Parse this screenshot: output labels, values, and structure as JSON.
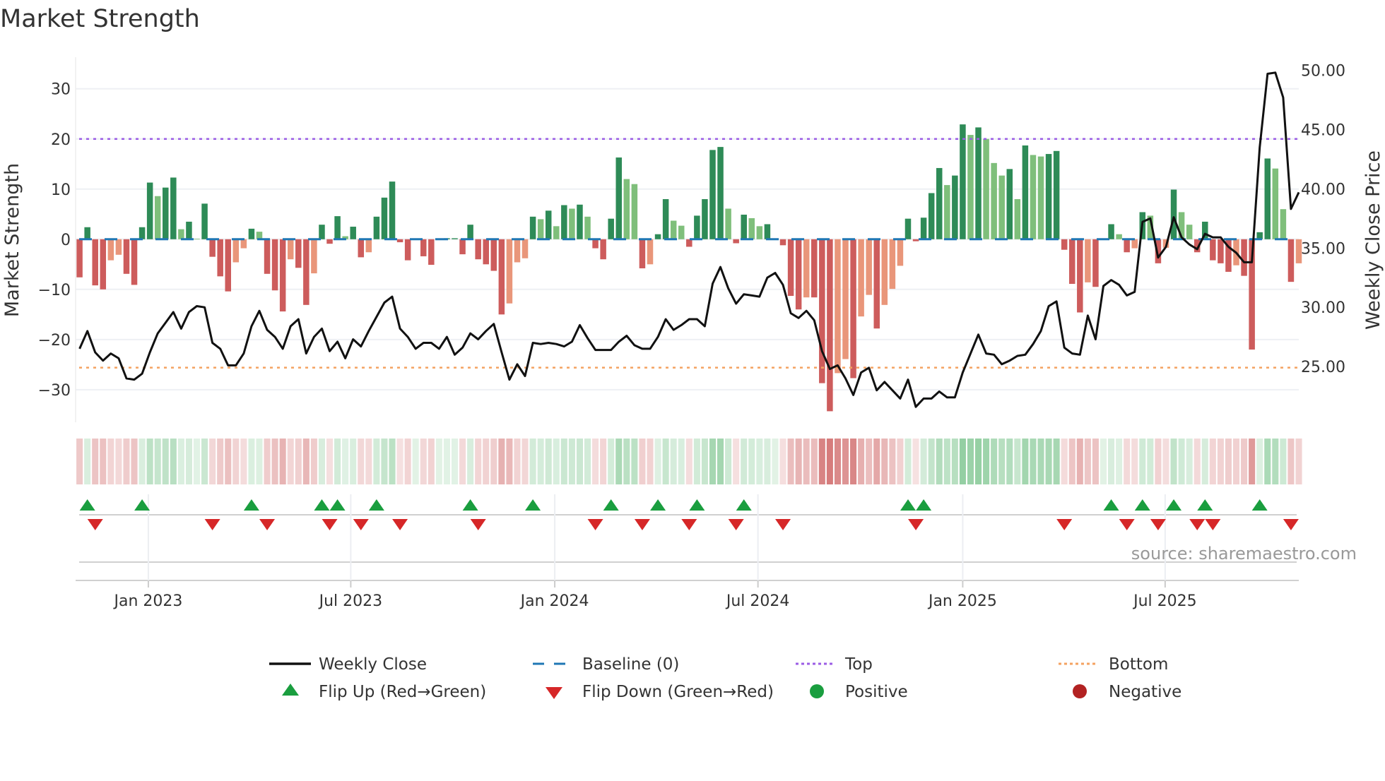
{
  "title": "Market Strength",
  "source": "source: sharemaestro.com",
  "colors": {
    "pos_strong": "#2e8b57",
    "pos_weak": "#7fbf7b",
    "neg_strong": "#cd5c5c",
    "neg_weak": "#e9967a",
    "line": "#111111",
    "baseline": "#1f77b4",
    "top": "#9b5de5",
    "bottom": "#f4a261",
    "flip_up": "#1a9e3f",
    "flip_down": "#d62728",
    "positive": "#1a9e3f",
    "negative": "#b22222"
  },
  "chart_data": {
    "type": "bar+line",
    "title": "Market Strength",
    "ylabel": "Market Strength",
    "y2label": "Weekly Close Price",
    "ylim": [
      -36.5,
      36.3
    ],
    "y2lim": [
      20.3,
      51.1
    ],
    "yticks": [
      30,
      20,
      10,
      0,
      -10,
      -20,
      -30
    ],
    "ytick_labels": [
      "30",
      "20",
      "10",
      "0",
      "−10",
      "−20",
      "−30"
    ],
    "y2ticks": [
      50,
      45,
      40,
      35,
      30,
      25
    ],
    "y2tick_labels": [
      "50.00",
      "45.00",
      "40.00",
      "35.00",
      "30.00",
      "25.00"
    ],
    "xticks": [
      {
        "label": "Jan 2023",
        "week": 8.8
      },
      {
        "label": "Jul 2023",
        "week": 34.7
      },
      {
        "label": "Jan 2024",
        "week": 60.8
      },
      {
        "label": "Jul 2024",
        "week": 86.8
      },
      {
        "label": "Jan 2025",
        "week": 113
      },
      {
        "label": "Jul 2025",
        "week": 138.9
      }
    ],
    "baseline": 0,
    "top": 20,
    "bottom": -25.6,
    "strength": [
      -7.6,
      2.4,
      -9.2,
      -10,
      -4.2,
      -3.1,
      -6.9,
      -9.1,
      2.4,
      11.3,
      8.6,
      10.3,
      12.3,
      2,
      3.5,
      0.1,
      7.1,
      -3.5,
      -7.4,
      -10.4,
      -4.6,
      -1.8,
      2.1,
      1.5,
      -6.9,
      -10.2,
      -14.4,
      -4,
      -5.7,
      -13.1,
      -6.8,
      2.9,
      -0.9,
      4.6,
      0.6,
      2.5,
      -3.6,
      -2.6,
      4.5,
      8.3,
      11.5,
      -0.6,
      -4.2,
      0,
      -3.4,
      -5.1,
      0,
      0.2,
      0.2,
      -3,
      2.9,
      -4,
      -5,
      -6.3,
      -15,
      -12.8,
      -4.6,
      -3.8,
      4.5,
      4,
      5.7,
      2.6,
      6.8,
      6.1,
      6.9,
      4.5,
      -1.8,
      -4,
      4.1,
      16.3,
      12,
      11,
      -5.8,
      -5,
      1,
      8,
      3.7,
      2.7,
      -1.5,
      4.7,
      8,
      17.8,
      18.4,
      6.1,
      -0.8,
      4.9,
      4.2,
      2.6,
      3,
      0,
      -1.2,
      -11.3,
      -14,
      -11.6,
      -11.6,
      -28.7,
      -34.3,
      -26.7,
      -23.9,
      -27.7,
      -15.4,
      -11.1,
      -17.8,
      -13.1,
      -9.9,
      -5.3,
      4.1,
      -0.4,
      4.3,
      9.2,
      14.2,
      10.8,
      12.7,
      22.9,
      20.8,
      22.3,
      20,
      15.2,
      12.7,
      14,
      8,
      18.7,
      16.8,
      16.5,
      17,
      17.6,
      -2.1,
      -8.9,
      -14.6,
      -8.6,
      -9.5,
      0,
      3,
      1,
      -2.6,
      -1.8,
      5.4,
      4.7,
      -4.8,
      -1.7,
      9.9,
      5.4,
      2.9,
      -2.6,
      3.5,
      -4.2,
      -4.8,
      -6.5,
      -5.2,
      -7.3,
      -22,
      1.4,
      16.1,
      14.1,
      6,
      -8.5,
      -4.8
    ],
    "close": [
      26.5,
      28.0,
      26.2,
      25.5,
      26.1,
      25.7,
      24.0,
      23.9,
      24.4,
      26.2,
      27.8,
      28.7,
      29.6,
      28.2,
      29.6,
      30.1,
      30.0,
      27.0,
      26.5,
      25.1,
      25.1,
      26.1,
      28.4,
      29.7,
      28.1,
      27.5,
      26.5,
      28.4,
      29.0,
      26.1,
      27.5,
      28.2,
      26.3,
      27.1,
      25.7,
      27.3,
      26.7,
      28.0,
      29.2,
      30.4,
      30.9,
      28.2,
      27.5,
      26.5,
      27.0,
      27.0,
      26.5,
      27.5,
      26.0,
      26.6,
      27.8,
      27.3,
      28.0,
      28.6,
      26.2,
      23.9,
      25.2,
      24.2,
      27.0,
      26.9,
      27.0,
      26.9,
      26.7,
      27.1,
      28.5,
      27.4,
      26.4,
      26.4,
      26.4,
      27.1,
      27.6,
      26.8,
      26.5,
      26.5,
      27.5,
      29.0,
      28.1,
      28.5,
      29.0,
      29.0,
      28.4,
      32.0,
      33.4,
      31.6,
      30.3,
      31.1,
      31.0,
      30.9,
      32.5,
      32.9,
      31.9,
      29.5,
      29.1,
      29.7,
      28.9,
      26.3,
      24.8,
      25.1,
      24.0,
      22.6,
      24.5,
      24.9,
      23.0,
      23.7,
      23.0,
      22.3,
      23.9,
      21.6,
      22.3,
      22.3,
      22.9,
      22.4,
      22.4,
      24.5,
      26.1,
      27.7,
      26.1,
      26.0,
      25.2,
      25.5,
      25.9,
      26.0,
      26.9,
      28.0,
      30.1,
      30.5,
      26.6,
      26.1,
      26.0,
      29.3,
      27.3,
      31.8,
      32.3,
      31.9,
      31.0,
      31.3,
      37.2,
      37.5,
      34.2,
      35.1,
      37.6,
      35.9,
      35.3,
      34.9,
      36.2,
      35.9,
      35.9,
      35.1,
      34.6,
      33.8,
      33.8,
      43.5,
      49.7,
      49.8,
      47.7,
      38.3,
      39.7
    ],
    "legend": [
      {
        "label": "Weekly Close",
        "symbol": "line"
      },
      {
        "label": "Baseline (0)",
        "symbol": "dashed"
      },
      {
        "label": "Top",
        "symbol": "dotted"
      },
      {
        "label": "Bottom",
        "symbol": "dotted"
      },
      {
        "label": "Flip Up (Red→Green)",
        "symbol": "triangle-up"
      },
      {
        "label": "Flip Down (Green→Red)",
        "symbol": "triangle-down"
      },
      {
        "label": "Positive",
        "symbol": "circle"
      },
      {
        "label": "Negative",
        "symbol": "circle"
      }
    ],
    "legend_position": "bottom-center"
  }
}
